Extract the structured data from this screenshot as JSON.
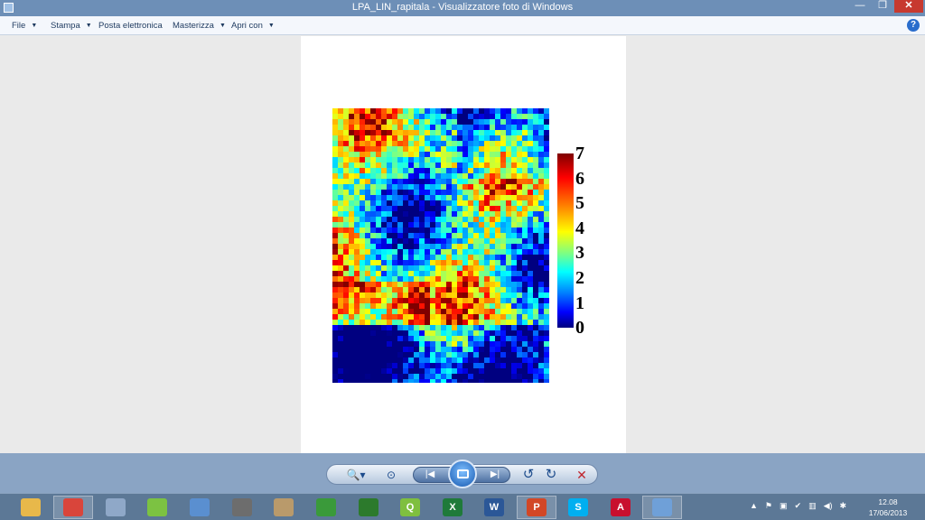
{
  "window": {
    "title": "LPA_LIN_rapitala - Visualizzatore foto di Windows",
    "controls": [
      "—",
      "❐",
      "✕"
    ]
  },
  "menu": {
    "items": [
      {
        "label": "File",
        "has_arrow": true
      },
      {
        "label": "Stampa",
        "has_arrow": true
      },
      {
        "label": "Posta elettronica",
        "has_arrow": false
      },
      {
        "label": "Masterizza",
        "has_arrow": true
      },
      {
        "label": "Apri con",
        "has_arrow": true
      }
    ],
    "help": "?"
  },
  "image": {
    "colorbar_ticks": [
      "7",
      "6",
      "5",
      "4",
      "3",
      "2",
      "1",
      "0"
    ],
    "colormap": "jet",
    "colorbar_range": [
      0,
      7
    ]
  },
  "toolbar": {
    "buttons": [
      {
        "name": "zoom-icon",
        "glyph": "🔍▾"
      },
      {
        "name": "fit-window-icon",
        "glyph": "⊙"
      },
      {
        "name": "previous-icon",
        "glyph": "|◀"
      },
      {
        "name": "next-icon",
        "glyph": "▶|"
      },
      {
        "name": "rotate-left-icon",
        "glyph": "↺"
      },
      {
        "name": "rotate-right-icon",
        "glyph": "↻"
      },
      {
        "name": "delete-icon",
        "glyph": "✕"
      }
    ]
  },
  "taskbar": {
    "apps": [
      {
        "name": "file-explorer-icon",
        "color": "#e8b84a",
        "glyph": ""
      },
      {
        "name": "chrome-icon",
        "color": "#d9453b",
        "glyph": "",
        "active": true
      },
      {
        "name": "calculator-icon",
        "color": "#8fa8c8",
        "glyph": ""
      },
      {
        "name": "app-green-icon",
        "color": "#7cc242",
        "glyph": ""
      },
      {
        "name": "remote-desktop-icon",
        "color": "#5a8fd0",
        "glyph": ""
      },
      {
        "name": "tool-icon",
        "color": "#6d6d6d",
        "glyph": ""
      },
      {
        "name": "paint-icon",
        "color": "#b99a6b",
        "glyph": ""
      },
      {
        "name": "plant-icon",
        "color": "#3a9a3a",
        "glyph": ""
      },
      {
        "name": "app-chart-icon",
        "color": "#2c7a2c",
        "glyph": ""
      },
      {
        "name": "qgis-icon",
        "color": "#7fbf3f",
        "glyph": "Q"
      },
      {
        "name": "excel-icon",
        "color": "#1f7a3a",
        "glyph": "X"
      },
      {
        "name": "word-icon",
        "color": "#2b5797",
        "glyph": "W"
      },
      {
        "name": "powerpoint-icon",
        "color": "#d24726",
        "glyph": "P",
        "active": true
      },
      {
        "name": "skype-icon",
        "color": "#00aff0",
        "glyph": "S"
      },
      {
        "name": "acrobat-icon",
        "color": "#c8102e",
        "glyph": "A"
      },
      {
        "name": "photo-viewer-icon",
        "color": "#6fa0d8",
        "glyph": "",
        "active": true
      }
    ],
    "clock_time": "12.08",
    "clock_date": "17/06/2013"
  }
}
